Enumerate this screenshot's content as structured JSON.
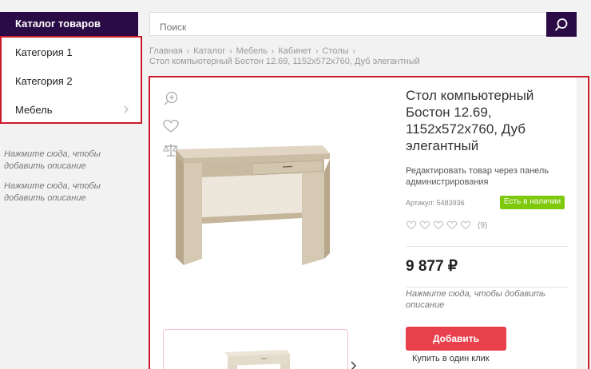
{
  "sidebar": {
    "catalog_button": "Каталог товаров",
    "categories": [
      {
        "label": "Категория 1"
      },
      {
        "label": "Категория 2"
      },
      {
        "label": "Мебель"
      }
    ],
    "notes": [
      "Нажмите сюда, чтобы добавить описание",
      "Нажмите сюда, чтобы добавить описание"
    ]
  },
  "search": {
    "placeholder": "Поиск"
  },
  "breadcrumb": {
    "items": [
      "Главная",
      "Каталог",
      "Мебель",
      "Кабинет",
      "Столы"
    ],
    "current": "Стол компьютерный Бостон 12.69, 1152x572x760, Дуб элегантный"
  },
  "product": {
    "title": "Стол компьютерный Бостон 12.69, 1152x572x760, Дуб элегантный",
    "edit_hint": "Редактировать товар через панель администрирования",
    "sku_label": "Артикул:",
    "sku": "5483936",
    "stock": "Есть в наличии",
    "rating_count": "(9)",
    "price": "9 877 ₽",
    "note": "Нажмите сюда, чтобы добавить описание",
    "add_button": "Добавить",
    "buy_one_click": "Купить в один клик"
  },
  "colors": {
    "brand_dark": "#2a0b45",
    "accent_red": "#e8414d",
    "highlight_border": "#cc1a2a",
    "stock_green": "#7ec90b"
  },
  "icons": [
    "search-icon",
    "chevron-right-icon",
    "zoom-icon",
    "heart-icon",
    "scales-icon",
    "star-icon",
    "chevron-right-icon"
  ]
}
